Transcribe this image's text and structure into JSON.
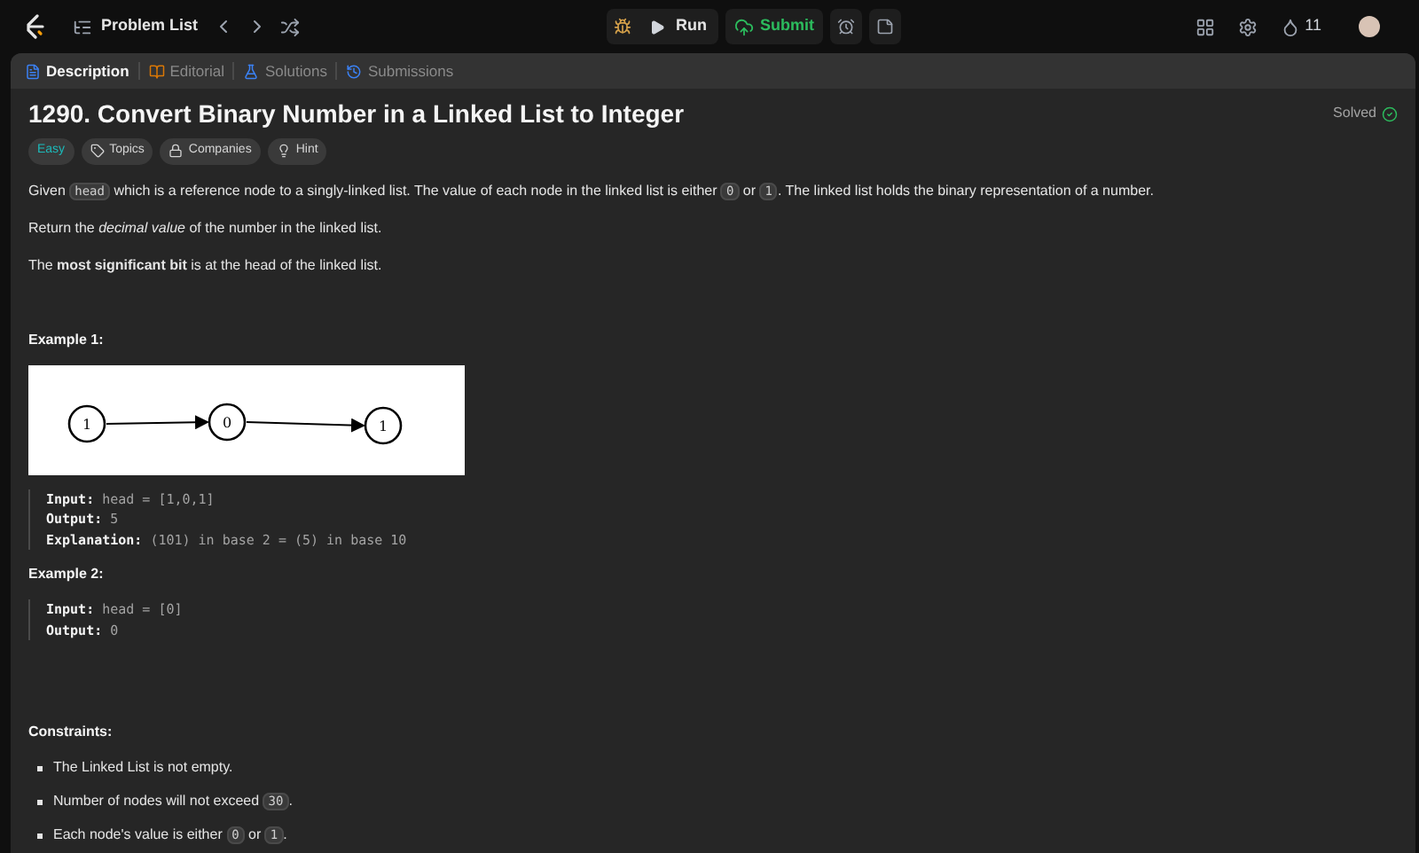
{
  "topbar": {
    "nav_label": "Problem List",
    "run_label": "Run",
    "submit_label": "Submit",
    "streak": "11"
  },
  "tabs": [
    {
      "label": "Description",
      "selected": true
    },
    {
      "label": "Editorial",
      "selected": false
    },
    {
      "label": "Solutions",
      "selected": false
    },
    {
      "label": "Submissions",
      "selected": false
    }
  ],
  "problem": {
    "title": "1290. Convert Binary Number in a Linked List to Integer",
    "status": "Solved",
    "difficulty": "Easy",
    "tags": [
      {
        "label": "Topics"
      },
      {
        "label": "Companies"
      },
      {
        "label": "Hint"
      }
    ],
    "paragraphs": [
      [
        {
          "kind": "text",
          "text": "Given "
        },
        {
          "kind": "code",
          "text": "head"
        },
        {
          "kind": "text",
          "text": " which is a reference node to a singly-linked list. The value of each node in the linked list is either "
        },
        {
          "kind": "code",
          "text": "0"
        },
        {
          "kind": "text",
          "text": " or "
        },
        {
          "kind": "code",
          "text": "1"
        },
        {
          "kind": "text",
          "text": ". The linked list holds the binary representation of a number."
        }
      ],
      [
        {
          "kind": "text",
          "text": "Return the *decimal value* of the number in the linked list."
        }
      ],
      [
        {
          "kind": "text",
          "text": "The **most significant bit** is at the head of the linked list."
        }
      ]
    ],
    "examples": [
      {
        "title": "Example 1:",
        "diagram": [
          "1",
          "0",
          "1"
        ],
        "lines": [
          {
            "label": "Input:",
            "value": "head = [1,0,1]"
          },
          {
            "label": "Output:",
            "value": "5"
          },
          {
            "label": "Explanation:",
            "value": "(101) in base 2 = (5) in base 10"
          }
        ]
      },
      {
        "title": "Example 2:",
        "lines": [
          {
            "label": "Input:",
            "value": "head = [0]"
          },
          {
            "label": "Output:",
            "value": "0"
          }
        ]
      }
    ],
    "constraints_title": "Constraints:",
    "constraints": [
      [
        {
          "kind": "text",
          "text": "The Linked List is not empty."
        }
      ],
      [
        {
          "kind": "text",
          "text": "Number of nodes will not exceed "
        },
        {
          "kind": "code",
          "text": "30"
        },
        {
          "kind": "text",
          "text": "."
        }
      ],
      [
        {
          "kind": "text",
          "text": "Each node's value is either "
        },
        {
          "kind": "code",
          "text": "0"
        },
        {
          "kind": "text",
          "text": " or "
        },
        {
          "kind": "code",
          "text": "1"
        },
        {
          "kind": "text",
          "text": "."
        }
      ]
    ]
  }
}
